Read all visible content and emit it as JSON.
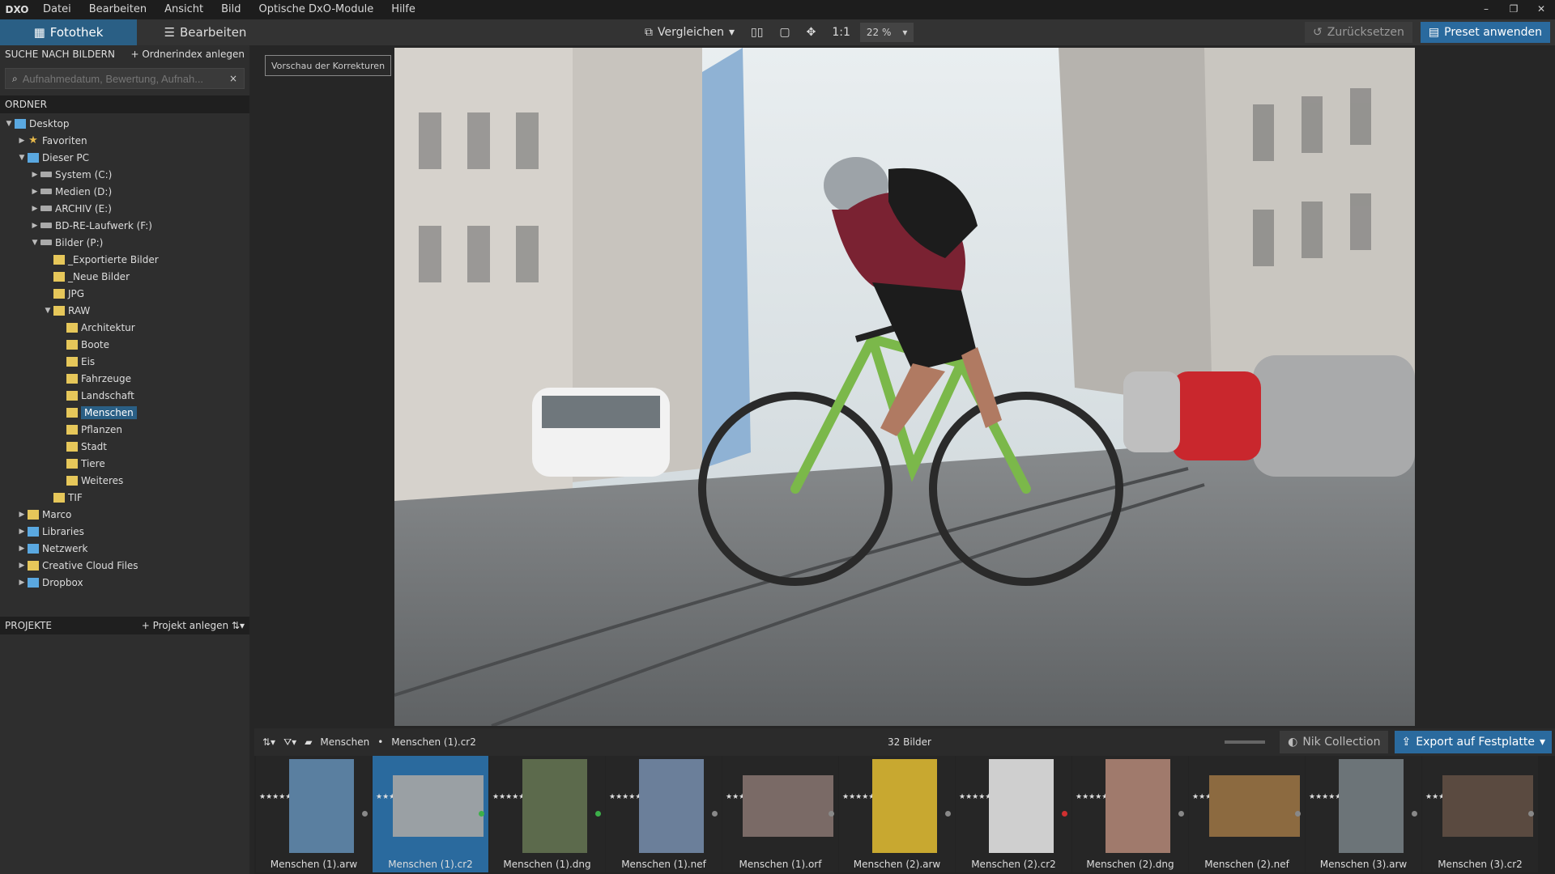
{
  "app": {
    "logo": "DXO"
  },
  "menu": [
    "Datei",
    "Bearbeiten",
    "Ansicht",
    "Bild",
    "Optische DxO-Module",
    "Hilfe"
  ],
  "window_buttons": [
    "–",
    "❐",
    "✕"
  ],
  "tabs": [
    {
      "label": "Fotothek",
      "active": true
    },
    {
      "label": "Bearbeiten",
      "active": false
    }
  ],
  "toolbar": {
    "compare": "Vergleichen",
    "one_to_one": "1:1",
    "zoom": "22 %",
    "reset": "Zurücksetzen",
    "preset": "Preset anwenden"
  },
  "search": {
    "header": "SUCHE NACH BILDERN",
    "add_index": "+ Ordnerindex anlegen",
    "placeholder": "Aufnahmedatum, Bewertung, Aufnah..."
  },
  "folders": {
    "header": "ORDNER",
    "items": [
      {
        "label": "Desktop",
        "level": 0,
        "arrow": "▼",
        "icon": "pc"
      },
      {
        "label": "Favoriten",
        "level": 1,
        "arrow": "▶",
        "icon": "star"
      },
      {
        "label": "Dieser PC",
        "level": 1,
        "arrow": "▼",
        "icon": "pc"
      },
      {
        "label": "System (C:)",
        "level": 2,
        "arrow": "▶",
        "icon": "drive"
      },
      {
        "label": "Medien (D:)",
        "level": 2,
        "arrow": "▶",
        "icon": "drive"
      },
      {
        "label": "ARCHIV (E:)",
        "level": 2,
        "arrow": "▶",
        "icon": "drive"
      },
      {
        "label": "BD-RE-Laufwerk (F:)",
        "level": 2,
        "arrow": "▶",
        "icon": "drive"
      },
      {
        "label": "Bilder (P:)",
        "level": 2,
        "arrow": "▼",
        "icon": "drive"
      },
      {
        "label": "_Exportierte Bilder",
        "level": 3,
        "arrow": "",
        "icon": "folder"
      },
      {
        "label": "_Neue Bilder",
        "level": 3,
        "arrow": "",
        "icon": "folder"
      },
      {
        "label": "JPG",
        "level": 3,
        "arrow": "",
        "icon": "folder"
      },
      {
        "label": "RAW",
        "level": 3,
        "arrow": "▼",
        "icon": "folder"
      },
      {
        "label": "Architektur",
        "level": 4,
        "arrow": "",
        "icon": "folder"
      },
      {
        "label": "Boote",
        "level": 4,
        "arrow": "",
        "icon": "folder"
      },
      {
        "label": "Eis",
        "level": 4,
        "arrow": "",
        "icon": "folder"
      },
      {
        "label": "Fahrzeuge",
        "level": 4,
        "arrow": "",
        "icon": "folder"
      },
      {
        "label": "Landschaft",
        "level": 4,
        "arrow": "",
        "icon": "folder"
      },
      {
        "label": "Menschen",
        "level": 4,
        "arrow": "",
        "icon": "folder",
        "selected": true
      },
      {
        "label": "Pflanzen",
        "level": 4,
        "arrow": "",
        "icon": "folder"
      },
      {
        "label": "Stadt",
        "level": 4,
        "arrow": "",
        "icon": "folder"
      },
      {
        "label": "Tiere",
        "level": 4,
        "arrow": "",
        "icon": "folder"
      },
      {
        "label": "Weiteres",
        "level": 4,
        "arrow": "",
        "icon": "folder"
      },
      {
        "label": "TIF",
        "level": 3,
        "arrow": "",
        "icon": "folder"
      },
      {
        "label": "Marco",
        "level": 1,
        "arrow": "▶",
        "icon": "folder"
      },
      {
        "label": "Libraries",
        "level": 1,
        "arrow": "▶",
        "icon": "pc"
      },
      {
        "label": "Netzwerk",
        "level": 1,
        "arrow": "▶",
        "icon": "pc"
      },
      {
        "label": "Creative Cloud Files",
        "level": 1,
        "arrow": "▶",
        "icon": "folder"
      },
      {
        "label": "Dropbox",
        "level": 1,
        "arrow": "▶",
        "icon": "pc"
      }
    ]
  },
  "projects": {
    "header": "PROJEKTE",
    "add": "+ Projekt anlegen"
  },
  "viewer": {
    "preview_button": "Vorschau der Korrekturen"
  },
  "filmbar": {
    "folder": "Menschen",
    "file": "Menschen (1).cr2",
    "count": "32 Bilder",
    "nik": "Nik Collection",
    "export": "Export auf Festplatte"
  },
  "thumbnails": [
    {
      "name": "Menschen (1).arw",
      "tone": "#5a7fa0"
    },
    {
      "name": "Menschen (1).cr2",
      "tone": "#9aa0a4",
      "selected": true,
      "dot": "#3cb04a"
    },
    {
      "name": "Menschen (1).dng",
      "tone": "#5c6a4c",
      "dot": "#3cb04a"
    },
    {
      "name": "Menschen (1).nef",
      "tone": "#6b7f9a"
    },
    {
      "name": "Menschen (1).orf",
      "tone": "#7a6a66"
    },
    {
      "name": "Menschen (2).arw",
      "tone": "#c8a830"
    },
    {
      "name": "Menschen (2).cr2",
      "tone": "#cfcfcf",
      "dot": "#d03030"
    },
    {
      "name": "Menschen (2).dng",
      "tone": "#a07a6c"
    },
    {
      "name": "Menschen (2).nef",
      "tone": "#8c6a40"
    },
    {
      "name": "Menschen (3).arw",
      "tone": "#6c7478"
    },
    {
      "name": "Menschen (3).cr2",
      "tone": "#5a4a40"
    }
  ]
}
